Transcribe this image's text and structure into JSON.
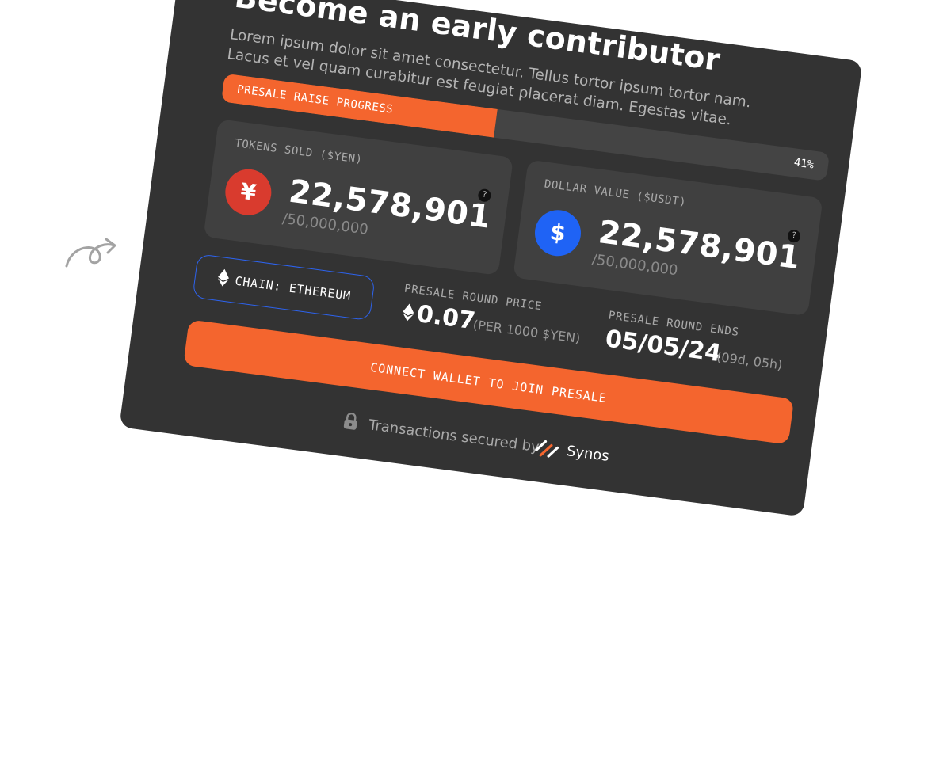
{
  "header": {
    "title": "Become an early contributor",
    "subtitle": "Lorem ipsum dolor sit amet consectetur. Tellus tortor ipsum tortor nam. Lacus et vel quam curabitur est feugiat placerat diam. Egestas vitae."
  },
  "progress": {
    "label": "PRESALE RAISE PROGRESS",
    "percent_text": "41%",
    "percent": 41
  },
  "tokens_sold": {
    "label": "TOKENS SOLD ($YEN)",
    "symbol": "¥",
    "value": "22,578,901",
    "total": "/50,000,000",
    "help": "?"
  },
  "dollar_value": {
    "label": "DOLLAR VALUE ($USDT)",
    "symbol": "$",
    "value": "22,578,901",
    "total": "/50,000,000",
    "help": "?"
  },
  "chain": {
    "label": "CHAIN: ETHEREUM"
  },
  "round_price": {
    "label": "PRESALE ROUND PRICE",
    "value": "0.07",
    "unit": "(PER 1000 $YEN)"
  },
  "round_ends": {
    "label": "PRESALE ROUND ENDS",
    "date": "05/05/24",
    "remaining": "(09d, 05h)"
  },
  "cta": {
    "label": "CONNECT WALLET TO JOIN PRESALE"
  },
  "footer": {
    "secured_text": "Transactions secured by",
    "brand": "Synos"
  },
  "colors": {
    "card": "#333333",
    "accent": "#f4652e",
    "yen_coin": "#d93b2e",
    "dollar_coin": "#1f63f5",
    "chain_border": "#2d63ee"
  },
  "icons": [
    "curved-arrow-icon",
    "yen-icon",
    "dollar-icon",
    "help-icon",
    "ethereum-icon",
    "lock-icon",
    "synos-logo-icon"
  ]
}
